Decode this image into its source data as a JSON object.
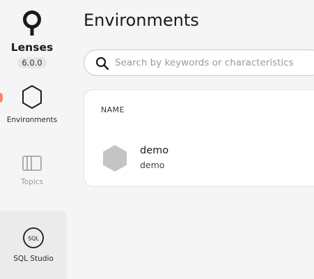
{
  "brand": {
    "name": "Lenses",
    "version": "6.0.0"
  },
  "sidebar": {
    "items": [
      {
        "label": "Environments",
        "icon": "hexagon-icon",
        "state": "active"
      },
      {
        "label": "Topics",
        "icon": "topics-icon",
        "state": "disabled"
      },
      {
        "label": "SQL Studio",
        "icon": "sql-icon",
        "icon_text": "SQL",
        "state": "hovered"
      }
    ],
    "notification_color": "#f2896b"
  },
  "main": {
    "title": "Environments",
    "search": {
      "placeholder": "Search by keywords or characteristics",
      "value": ""
    },
    "table": {
      "column_header": "NAME",
      "rows": [
        {
          "name": "demo",
          "subtitle": "demo",
          "icon": "hexagon-icon",
          "icon_color": "#c4c4c4"
        }
      ]
    }
  }
}
